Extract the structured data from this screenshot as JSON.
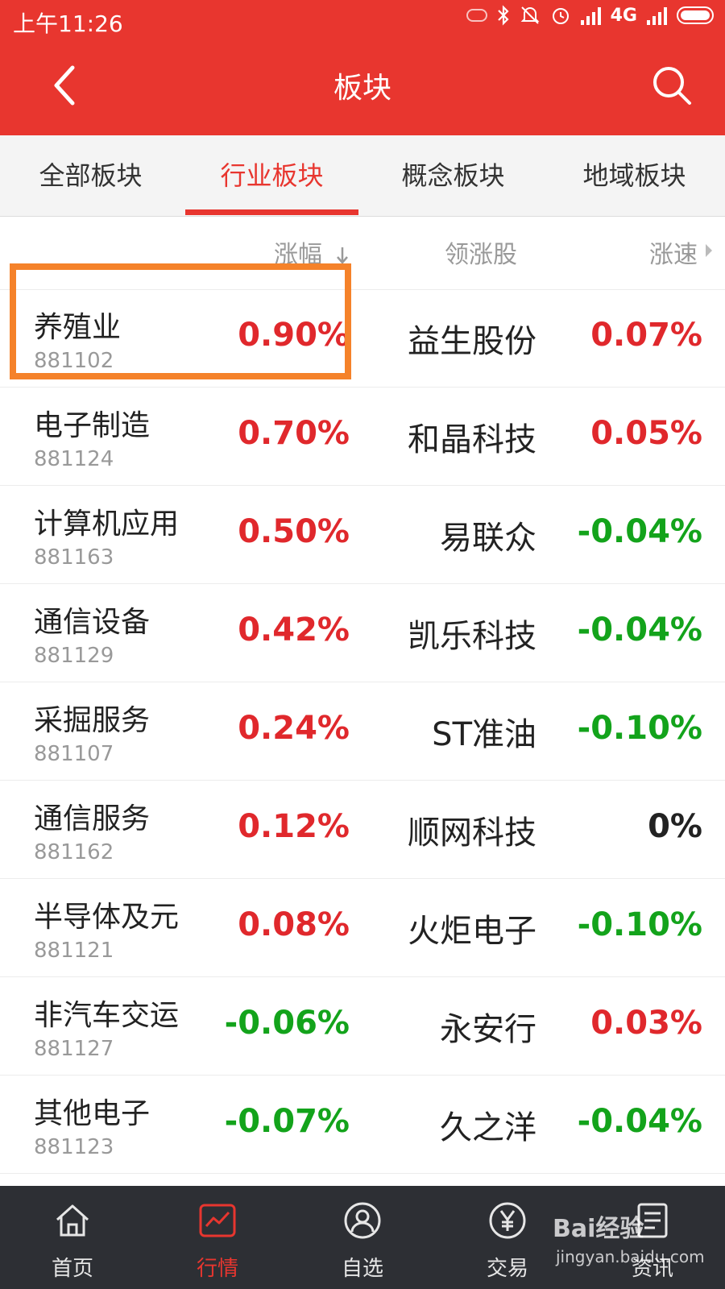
{
  "status_bar": {
    "time": "上午11:26",
    "network": "4G"
  },
  "nav": {
    "title": "板块"
  },
  "tabs": [
    {
      "label": "全部板块"
    },
    {
      "label": "行业板块"
    },
    {
      "label": "概念板块"
    },
    {
      "label": "地域板块"
    }
  ],
  "columns": {
    "change": "涨幅",
    "leader": "领涨股",
    "speed": "涨速"
  },
  "rows": [
    {
      "name": "养殖业",
      "code": "881102",
      "change": "0.90%",
      "leader": "益生股份",
      "speed": "0.07%"
    },
    {
      "name": "电子制造",
      "code": "881124",
      "change": "0.70%",
      "leader": "和晶科技",
      "speed": "0.05%"
    },
    {
      "name": "计算机应用",
      "code": "881163",
      "change": "0.50%",
      "leader": "易联众",
      "speed": "-0.04%"
    },
    {
      "name": "通信设备",
      "code": "881129",
      "change": "0.42%",
      "leader": "凯乐科技",
      "speed": "-0.04%"
    },
    {
      "name": "采掘服务",
      "code": "881107",
      "change": "0.24%",
      "leader": "ST准油",
      "speed": "-0.10%"
    },
    {
      "name": "通信服务",
      "code": "881162",
      "change": "0.12%",
      "leader": "顺网科技",
      "speed": "0%"
    },
    {
      "name": "半导体及元",
      "code": "881121",
      "change": "0.08%",
      "leader": "火炬电子",
      "speed": "-0.10%"
    },
    {
      "name": "非汽车交运",
      "code": "881127",
      "change": "-0.06%",
      "leader": "永安行",
      "speed": "0.03%"
    },
    {
      "name": "其他电子",
      "code": "881123",
      "change": "-0.07%",
      "leader": "久之洋",
      "speed": "-0.04%"
    }
  ],
  "bottom_nav": [
    {
      "label": "首页",
      "icon": "home-icon"
    },
    {
      "label": "行情",
      "icon": "chart-icon"
    },
    {
      "label": "自选",
      "icon": "user-icon"
    },
    {
      "label": "交易",
      "icon": "yen-icon"
    },
    {
      "label": "资讯",
      "icon": "news-icon"
    }
  ],
  "watermark": {
    "brand": "Bai经验",
    "url": "jingyan.baidu.com"
  },
  "colors": {
    "brand": "#e8362f",
    "up": "#e0282c",
    "down": "#13a31b",
    "highlight": "#f5822a",
    "bottom_bar": "#2d2f34"
  }
}
